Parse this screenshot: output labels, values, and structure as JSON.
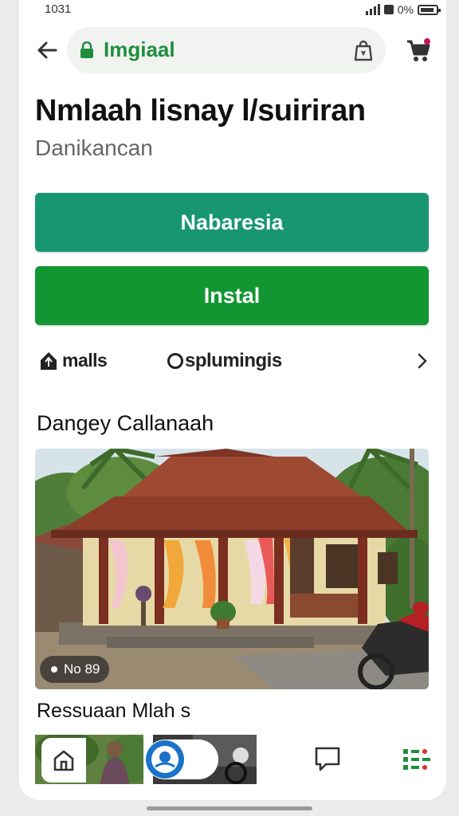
{
  "status_bar": {
    "time": "1031",
    "battery": "0%"
  },
  "browser": {
    "url_text": "Imgiaal"
  },
  "listing": {
    "title": "Nmlaah lisnay l/suiriran",
    "subtitle": "Danikancan",
    "primary_button": "Nabaresia",
    "install_button": "Instal"
  },
  "chips": {
    "first": "malls",
    "second": "splumingis"
  },
  "section_title": "Dangey Callanaah",
  "photo": {
    "badge_text": "No 89"
  },
  "section2_title": "Ressuaan Mlah s",
  "colors": {
    "accent_teal": "#189671",
    "accent_green": "#129632",
    "url_green": "#1e8e3e"
  },
  "icons": [
    "back-arrow-icon",
    "lock-icon",
    "shopping-bag-icon",
    "cart-icon",
    "tag-icon",
    "chevron-right-icon",
    "home-icon",
    "chat-icon",
    "apps-icon"
  ]
}
